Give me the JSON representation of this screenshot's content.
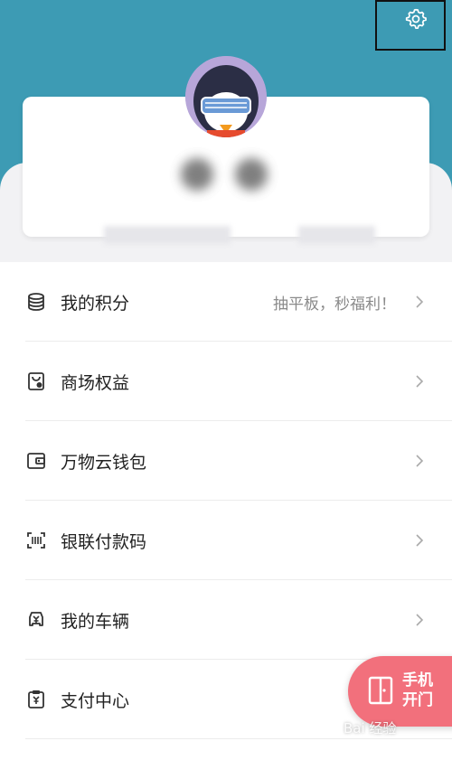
{
  "menu": {
    "items": [
      {
        "icon": "coins-stack-icon",
        "label": "我的积分",
        "promo": "抽平板，秒福利！"
      },
      {
        "icon": "mall-bag-icon",
        "label": "商场权益",
        "promo": ""
      },
      {
        "icon": "wallet-icon",
        "label": "万物云钱包",
        "promo": ""
      },
      {
        "icon": "scan-code-icon",
        "label": "银联付款码",
        "promo": ""
      },
      {
        "icon": "car-icon",
        "label": "我的车辆",
        "promo": ""
      },
      {
        "icon": "payment-clipboard-icon",
        "label": "支付中心",
        "promo": ""
      }
    ]
  },
  "fab": {
    "label": "手机开门"
  },
  "watermark": {
    "text": "Bai 经验"
  },
  "colors": {
    "header": "#3d9bb4",
    "fab": "#f2707c"
  }
}
